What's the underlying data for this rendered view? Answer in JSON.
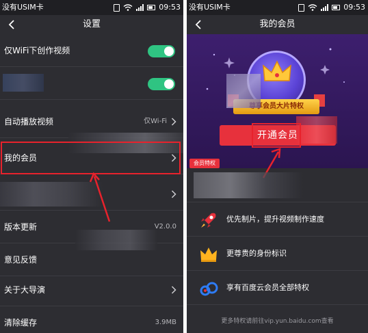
{
  "status_bar": {
    "carrier": "没有USIM卡",
    "time": "09:53"
  },
  "settings": {
    "title": "设置",
    "items": [
      {
        "label": "仅WiFi下创作视频",
        "control": "toggle",
        "on": true
      },
      {
        "label": "",
        "control": "toggle",
        "on": true
      },
      {
        "label": "自动播放视频",
        "value": "仅Wi-Fi",
        "control": "chevron"
      },
      {
        "label": "我的会员",
        "control": "chevron"
      },
      {
        "label": "",
        "control": "chevron"
      },
      {
        "label": "版本更新",
        "value": "V2.0.0"
      },
      {
        "label": "意见反馈"
      },
      {
        "label": "关于大导演",
        "control": "chevron"
      },
      {
        "label": "清除缓存",
        "value": "3.9MB"
      }
    ]
  },
  "membership": {
    "title": "我的会员",
    "banner_text": "尊享会员大片特权",
    "open_button": "开通会员",
    "perks_tag": "会员特权",
    "perks": [
      {
        "label": "优先制片，提升视频制作速度",
        "icon": "rocket-icon"
      },
      {
        "label": "更尊贵的身份标识",
        "icon": "crown-icon"
      },
      {
        "label": "享有百度云会员全部特权",
        "icon": "baidu-cloud-icon"
      }
    ],
    "footer": "更多特权请前往vip.yun.baidu.com查看"
  },
  "colors": {
    "background": "#2d2d32",
    "toggle_on": "#2fc482",
    "accent_red": "#e7313c",
    "highlight_border": "#e8222c",
    "hero_purple": "#3d1f6e"
  }
}
